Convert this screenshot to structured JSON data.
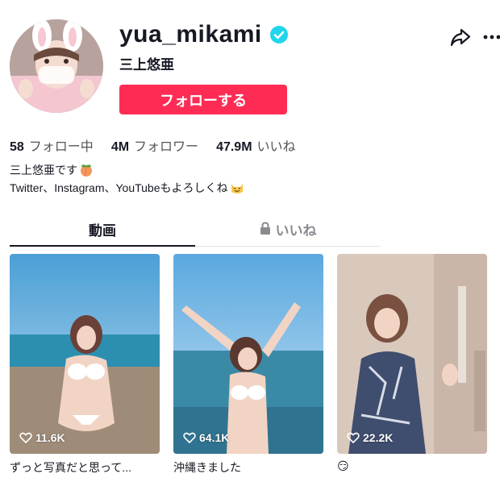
{
  "profile": {
    "username": "yua_mikami",
    "nickname": "三上悠亜",
    "follow_label": "フォローする",
    "avatar_icon": "avatar-photo",
    "verified_icon": "verified-badge-icon",
    "verified_color": "#20d5ec"
  },
  "actions": {
    "share_icon": "share-icon",
    "more_icon": "more-icon"
  },
  "stats": [
    {
      "value": "58",
      "label": "フォロー中"
    },
    {
      "value": "4M",
      "label": "フォロワー"
    },
    {
      "value": "47.9M",
      "label": "いいね"
    }
  ],
  "bio": {
    "line1": "三上悠亜です",
    "line2": "Twitter、Instagram、YouTubeもよろしくね"
  },
  "tabs": {
    "videos": "動画",
    "likes": "いいね"
  },
  "videos": [
    {
      "views": "11.6K",
      "caption": "ずっと写真だと思って..."
    },
    {
      "views": "64.1K",
      "caption": "沖縄きました"
    },
    {
      "views": "22.2K",
      "caption": "😏"
    }
  ],
  "colors": {
    "accent": "#fe2c55",
    "text": "#161823",
    "muted": "#8a8b91"
  }
}
